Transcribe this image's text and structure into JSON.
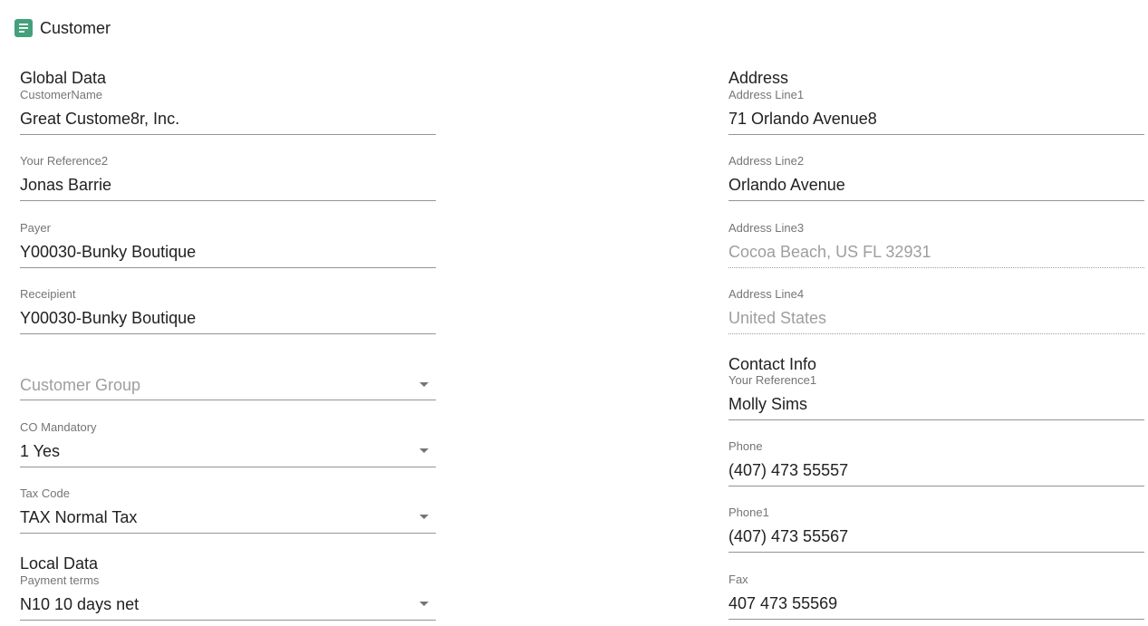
{
  "header": {
    "title": "Customer",
    "icon": "document-icon",
    "icon_color": "#43a07a"
  },
  "left": {
    "global_title": "Global Data",
    "customer_name": {
      "label": "CustomerName",
      "value": "Great Custome8r, Inc."
    },
    "your_reference2": {
      "label": "Your Reference2",
      "value": "Jonas Barrie"
    },
    "payer": {
      "label": "Payer",
      "value": "Y00030-Bunky Boutique"
    },
    "recipient": {
      "label": "Receipient",
      "value": "Y00030-Bunky Boutique"
    },
    "customer_group": {
      "placeholder": "Customer Group"
    },
    "co_mandatory": {
      "label": "CO Mandatory",
      "value": "1 Yes"
    },
    "tax_code": {
      "label": "Tax Code",
      "value": "TAX Normal Tax"
    },
    "local_title": "Local Data",
    "payment_terms": {
      "label": "Payment terms",
      "value": "N10 10 days net"
    }
  },
  "right": {
    "address_title": "Address",
    "address_line1": {
      "label": "Address Line1",
      "value": "71 Orlando Avenue8"
    },
    "address_line2": {
      "label": "Address Line2",
      "value": "Orlando Avenue"
    },
    "address_line3": {
      "label": "Address Line3",
      "value": "Cocoa Beach, US FL 32931"
    },
    "address_line4": {
      "label": "Address Line4",
      "value": "United States"
    },
    "contact_title": "Contact Info",
    "your_reference1": {
      "label": "Your Reference1",
      "value": "Molly Sims"
    },
    "phone": {
      "label": "Phone",
      "value": "(407) 473 55557"
    },
    "phone1": {
      "label": "Phone1",
      "value": "(407) 473 55567"
    },
    "fax": {
      "label": "Fax",
      "value": "407 473 55569"
    }
  }
}
